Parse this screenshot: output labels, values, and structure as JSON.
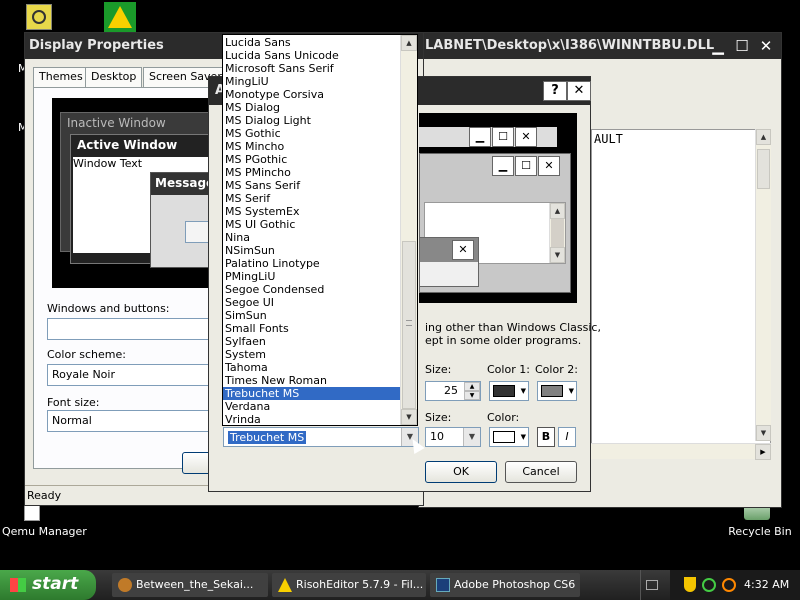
{
  "desktop": {
    "icons": [
      {
        "label": "Qemu Manager"
      },
      {
        "label": "Recycle Bin"
      }
    ],
    "partial_left_letters": [
      "M",
      "M"
    ]
  },
  "display_properties": {
    "title": "Display Properties",
    "tabs": [
      "Themes",
      "Desktop",
      "Screen Saver"
    ],
    "preview": {
      "inactive_window": "Inactive Window",
      "active_window": "Active Window",
      "window_text": "Window Text",
      "message_box": "Message"
    },
    "windows_and_buttons_label": "Windows and buttons:",
    "windows_and_buttons_value": "",
    "color_scheme_label": "Color scheme:",
    "color_scheme_value": "Royale Noir",
    "font_size_label": "Font size:",
    "font_size_value": "Normal"
  },
  "background_window": {
    "title": "LABNET\\Desktop\\x\\I386\\WINNTBBU.DLL",
    "content_text": "AULT",
    "status": "Ready"
  },
  "advanced": {
    "title_letter": "A",
    "note": "ing other than Windows Classic,\nept in some older programs.",
    "size_label": "Size:",
    "size_value": "25",
    "color1_label": "Color 1:",
    "color2_label": "Color 2:",
    "color1": "#333333",
    "color2": "#808080",
    "font_size_label": "Size:",
    "font_size_value": "10",
    "font_color_label": "Color:",
    "font_color": "#ffffff",
    "bold": "B",
    "italic": "I",
    "ok": "OK",
    "cancel": "Cancel",
    "font_selected": "Trebuchet MS"
  },
  "font_list": [
    "Lucida Sans",
    "Lucida Sans Unicode",
    "Microsoft Sans Serif",
    "MingLiU",
    "Monotype Corsiva",
    "MS Dialog",
    "MS Dialog Light",
    "MS Gothic",
    "MS Mincho",
    "MS PGothic",
    "MS PMincho",
    "MS Sans Serif",
    "MS Serif",
    "MS SystemEx",
    "MS UI Gothic",
    "Nina",
    "NSimSun",
    "Palatino Linotype",
    "PMingLiU",
    "Segoe Condensed",
    "Segoe UI",
    "SimSun",
    "Small Fonts",
    "Sylfaen",
    "System",
    "Tahoma",
    "Times New Roman",
    "Trebuchet MS",
    "Verdana",
    "Vrinda"
  ],
  "taskbar": {
    "start": "start",
    "items": [
      "Between_the_Sekai...",
      "RisohEditor 5.7.9 - Fil...",
      "Adobe Photoshop CS6"
    ],
    "clock": "4:32 AM"
  },
  "colors": {
    "taskbar": "#2e2e2e",
    "start": "#3c8f3a",
    "selection": "#316ac5"
  }
}
